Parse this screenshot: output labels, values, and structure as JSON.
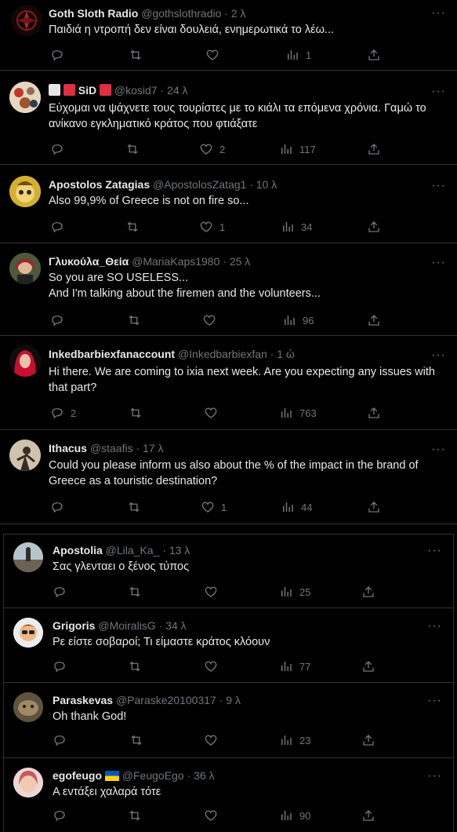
{
  "tweets": [
    {
      "name": "Goth Sloth Radio",
      "handle": "@gothslothradio",
      "time": "2 λ",
      "text": "Παιδιά η ντροπή δεν είναι δουλειά, ενημερωτικά το λέω...",
      "replies": "",
      "likes": "",
      "views": "1"
    },
    {
      "name": "SiD",
      "handle": "@kosid7",
      "time": "24 λ",
      "text": "Εύχομαι να ψάχνετε τους τουρίστες με το κιάλι τα επόμενα χρόνια. Γαμώ το ανίκανο εγκληματικό κράτος που φτιάξατε",
      "replies": "",
      "likes": "2",
      "views": "117"
    },
    {
      "name": "Apostolos Zatagias",
      "handle": "@ApostolosZatag1",
      "time": "10 λ",
      "text": "Also 99,9% of Greece is not on fire so...",
      "replies": "",
      "likes": "1",
      "views": "34"
    },
    {
      "name": "Γλυκούλα_Θεία",
      "handle": "@MariaKaps1980",
      "time": "25 λ",
      "text": "So you are SO USELESS...\nAnd I'm talking about the firemen and the volunteers...",
      "replies": "",
      "likes": "",
      "views": "96"
    },
    {
      "name": "Inkedbarbiexfanaccount",
      "handle": "@Inkedbarbiexfan",
      "time": "1 ώ",
      "text": "Hi there. We are coming to ixia next week. Are you expecting any issues with that part?",
      "replies": "2",
      "likes": "",
      "views": "763"
    },
    {
      "name": "Ithacus",
      "handle": "@staafis",
      "time": "17 λ",
      "text": "Could you please inform us also about the % of the impact in the brand of Greece as a touristic destination?",
      "replies": "",
      "likes": "1",
      "views": "44"
    },
    {
      "name": "Apostolia",
      "handle": "@Lila_Ka_",
      "time": "13 λ",
      "text": "Σας γλενταει ο ξένος τύπος",
      "replies": "",
      "likes": "",
      "views": "25"
    },
    {
      "name": "Grigoris",
      "handle": "@MoiralisG",
      "time": "34 λ",
      "text": "Ρε είστε σοβαροί; Τι είμαστε κράτος κλόουν",
      "replies": "",
      "likes": "",
      "views": "77"
    },
    {
      "name": "Paraskevas",
      "handle": "@Paraske20100317",
      "time": "9 λ",
      "text": "Oh thank God!",
      "replies": "",
      "likes": "",
      "views": "23"
    },
    {
      "name": "egofeugo",
      "handle": "@FeugoEgo",
      "time": "36 λ",
      "text": "Α εντάξει χαλαρά τότε",
      "replies": "",
      "likes": "",
      "views": "90"
    }
  ],
  "more_label": "···",
  "dot": "·",
  "colors": {
    "background": "#000000",
    "text": "#e7e9ea",
    "muted": "#71767b",
    "border": "#2f3336"
  }
}
